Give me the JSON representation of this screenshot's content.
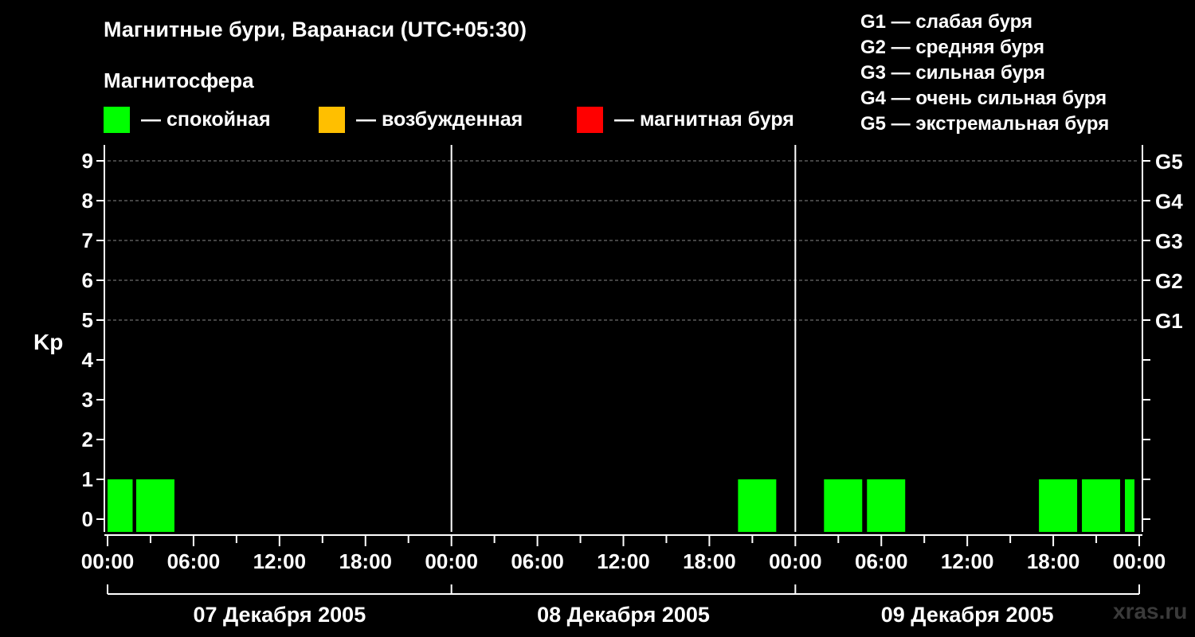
{
  "header": {
    "title": "Магнитные бури, Варанаси (UTC+05:30)",
    "subtitle": "Магнитосфера"
  },
  "legend": [
    {
      "label": "— спокойная",
      "color": "#00ff00"
    },
    {
      "label": "— возбужденная",
      "color": "#ffbf00"
    },
    {
      "label": "— магнитная буря",
      "color": "#ff0000"
    }
  ],
  "storm_scale": [
    "G1 — слабая буря",
    "G2 — средняя буря",
    "G3 — сильная буря",
    "G4 — очень сильная буря",
    "G5 — экстремальная буря"
  ],
  "watermark": "xras.ru",
  "chart_data": {
    "type": "bar",
    "ylabel": "Kp",
    "xlabel": "",
    "ylim": [
      0,
      9
    ],
    "y_ticks": [
      "0",
      "1",
      "2",
      "3",
      "4",
      "5",
      "6",
      "7",
      "8",
      "9"
    ],
    "right_ticks": [
      {
        "value": 5,
        "label": "G1"
      },
      {
        "value": 6,
        "label": "G2"
      },
      {
        "value": 7,
        "label": "G3"
      },
      {
        "value": 8,
        "label": "G4"
      },
      {
        "value": 9,
        "label": "G5"
      }
    ],
    "x_tick_labels": [
      "00:00",
      "06:00",
      "12:00",
      "18:00",
      "00:00",
      "06:00",
      "12:00",
      "18:00",
      "00:00",
      "06:00",
      "12:00",
      "18:00",
      "00:00"
    ],
    "dates": [
      "07 Декабря 2005",
      "08 Декабря 2005",
      "09 Декабря 2005"
    ],
    "grid": true,
    "bar_color": "#00ff00",
    "bars": [
      {
        "start": "07 Декабря 2005 00:00",
        "end": "07 Декабря 2005 01:45",
        "kp": 1
      },
      {
        "start": "07 Декабря 2005 02:00",
        "end": "07 Декабря 2005 04:40",
        "kp": 1
      },
      {
        "start": "08 Декабря 2005 20:00",
        "end": "08 Декабря 2005 22:40",
        "kp": 1
      },
      {
        "start": "09 Декабря 2005 02:00",
        "end": "09 Декабря 2005 04:40",
        "kp": 1
      },
      {
        "start": "09 Декабря 2005 05:00",
        "end": "09 Декабря 2005 07:40",
        "kp": 1
      },
      {
        "start": "09 Декабря 2005 17:00",
        "end": "09 Декабря 2005 19:40",
        "kp": 1
      },
      {
        "start": "09 Декабря 2005 20:00",
        "end": "09 Декабря 2005 22:40",
        "kp": 1
      },
      {
        "start": "09 Декабря 2005 23:00",
        "end": "09 Декабря 2005 23:40",
        "kp": 1
      }
    ]
  }
}
